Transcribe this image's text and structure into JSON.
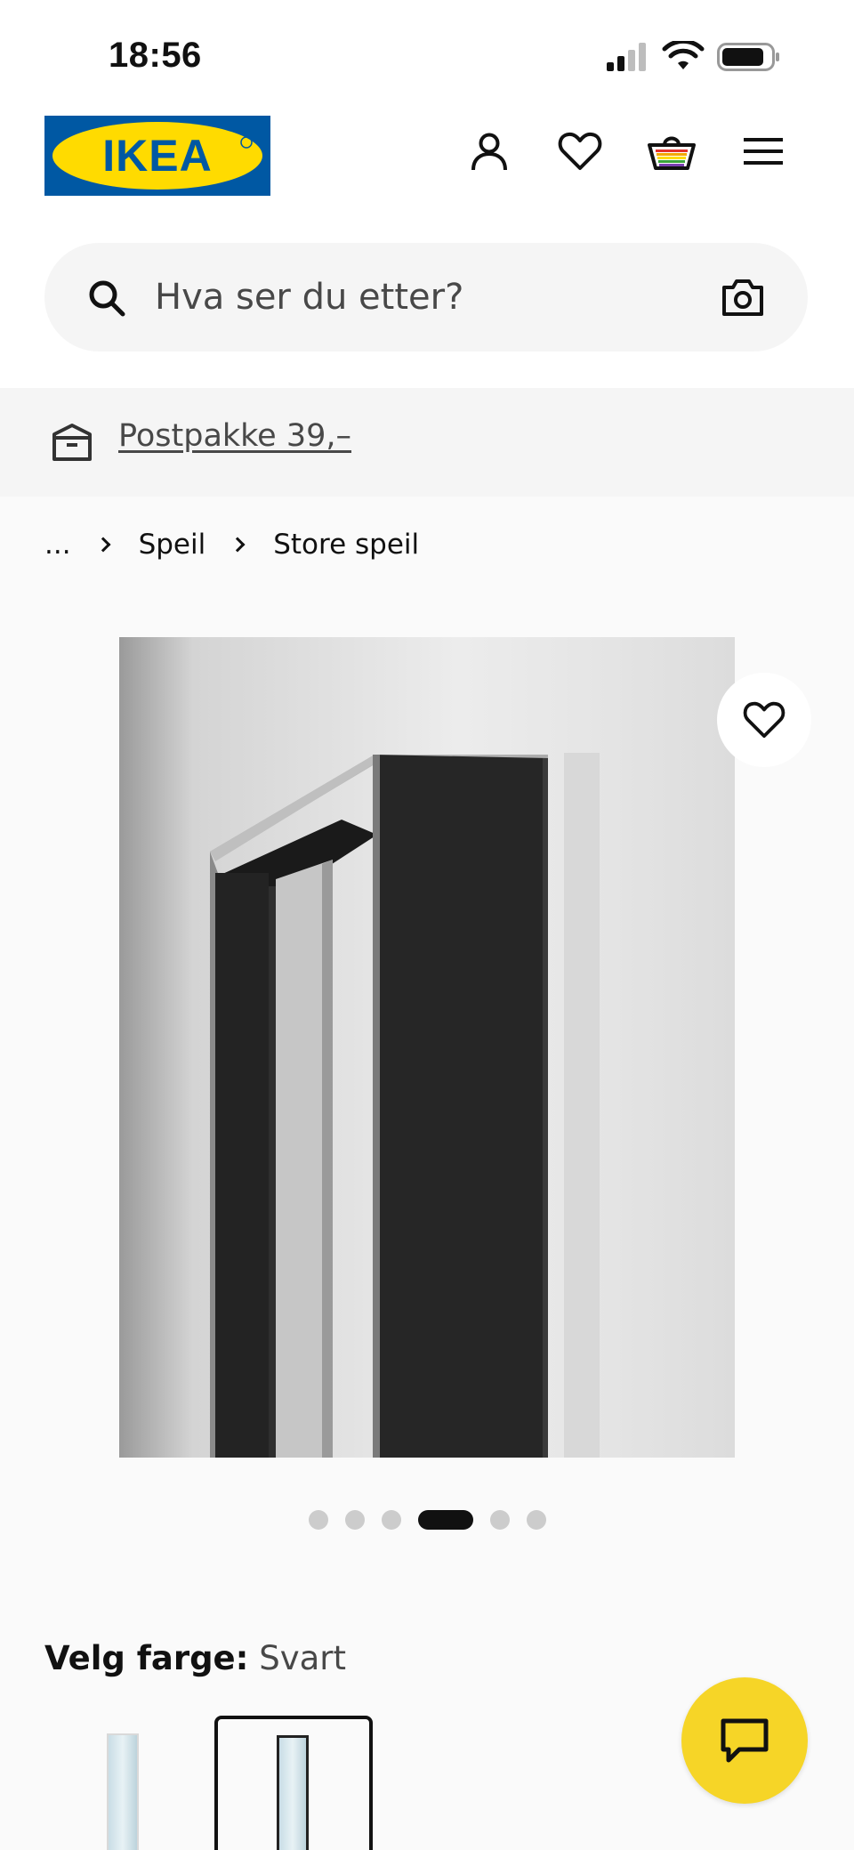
{
  "status_bar": {
    "time": "18:56"
  },
  "header": {
    "logo_text": "IKEA",
    "brand_colors": {
      "blue": "#0058a3",
      "yellow": "#ffdb00"
    },
    "icons": [
      "profile-icon",
      "heart-icon",
      "shopping-basket-icon",
      "hamburger-menu-icon"
    ]
  },
  "search": {
    "placeholder": "Hva ser du etter?",
    "icons": [
      "search-icon",
      "camera-icon"
    ]
  },
  "banner": {
    "link_text": "Postpakke 39,–",
    "icon": "delivery-box-icon"
  },
  "breadcrumb": {
    "items": [
      "...",
      "Speil",
      "Store speil"
    ]
  },
  "product": {
    "image_description_icon": "product-image",
    "carousel": {
      "count": 6,
      "active_index": 3
    }
  },
  "color_picker": {
    "label": "Velg farge:",
    "value": "Svart",
    "swatches": [
      "swatch-white-frame",
      "swatch-black-frame"
    ],
    "selected_index": 1
  },
  "chat": {
    "icon": "chat-bubble-icon",
    "color": "#f6d527"
  }
}
